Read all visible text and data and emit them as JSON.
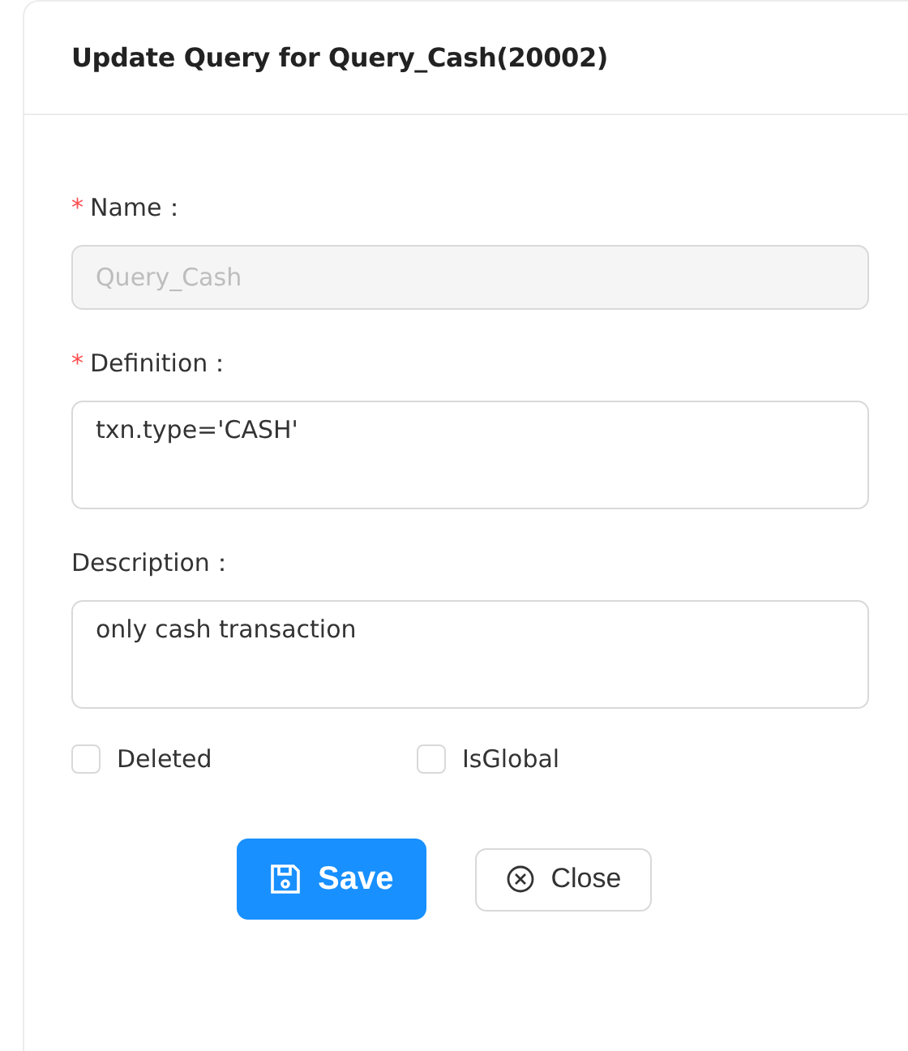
{
  "dialog": {
    "title": "Update Query for Query_Cash(20002)"
  },
  "fields": [
    {
      "label": "Name：",
      "marker": "*",
      "kind": "input",
      "value": "Query_Cash",
      "disabled": true
    },
    {
      "label": "Definition：",
      "marker": "*",
      "kind": "textarea",
      "value": "txn.type='CASH'",
      "disabled": false
    },
    {
      "label": "Description：",
      "kind": "textarea",
      "value": "only cash transaction",
      "disabled": false
    }
  ],
  "checkboxes": [
    {
      "label": "Deleted",
      "checked": false
    },
    {
      "label": "IsGlobal",
      "checked": false
    }
  ],
  "buttons": [
    {
      "label": "Save",
      "kind": "primary"
    },
    {
      "label": "Close",
      "kind": "default"
    }
  ]
}
